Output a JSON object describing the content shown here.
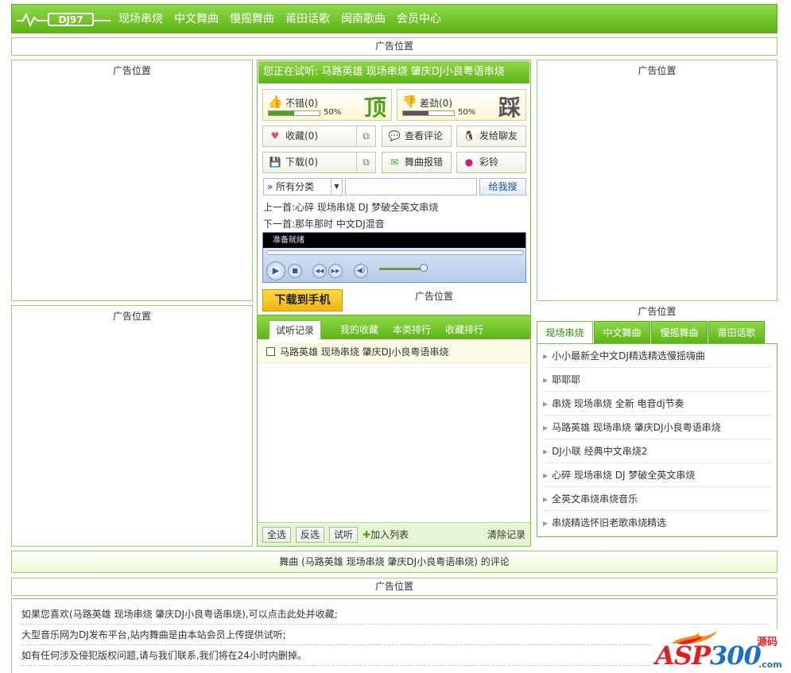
{
  "header": {
    "logo_text": "DJ97",
    "nav": [
      "现场串烧",
      "中文舞曲",
      "慢摇舞曲",
      "莆田话歌",
      "闽南歌曲",
      "会员中心"
    ]
  },
  "ads": {
    "label": "广告位置"
  },
  "player": {
    "now_playing": "您正在试听: 马路英雄 现场串烧 肇庆DJ小良粤语串烧",
    "up_vote": {
      "label": "不错(0)",
      "percent_text": "50%",
      "percent": 50,
      "big": "顶",
      "color": "#4ca21b"
    },
    "down_vote": {
      "label": "差劲(0)",
      "percent_text": "50%",
      "percent": 50,
      "big": "踩",
      "color": "#555555"
    },
    "actions": {
      "favorite": "收藏(0)",
      "comments": "查看评论",
      "send_friend": "发给聊友",
      "download": "下载(0)",
      "report": "舞曲报错",
      "ringtone": "彩铃"
    },
    "category_select": "» 所有分类",
    "search_placeholder": "",
    "search_button": "给我搜",
    "prev": {
      "prefix": "上一首:",
      "name": "心碎 现场串烧 DJ 梦破全英文串烧"
    },
    "next": {
      "prefix": "下一首:",
      "name": "那年那时 中文DJ混音"
    },
    "screen_text": "准备就绪",
    "download_phone": "下载到手机"
  },
  "playlist": {
    "tabs": [
      "试听记录",
      "我的收藏",
      "本类排行",
      "收藏排行"
    ],
    "rows": [
      "马路英雄 现场串烧 肇庆DJ小良粤语串烧"
    ],
    "select_all": "全选",
    "invert": "反选",
    "listen": "试听",
    "add_to_list": "加入列表",
    "clear": "清除记录"
  },
  "right_list": {
    "tabs": [
      "现场串烧",
      "中文舞曲",
      "慢摇舞曲",
      "莆田话歌"
    ],
    "items": [
      "小小最新全中文DJ精选精选慢摇嗨曲",
      "耶耶耶",
      "串烧 现场串烧 全新 电音dj节奏",
      "马路英雄 现场串烧 肇庆DJ小良粤语串烧",
      "DJ小联 经典中文串烧2",
      "心碎 现场串烧 DJ 梦破全英文串烧",
      "全英文串烧串烧音乐",
      "串烧精选怀旧老歌串烧精选"
    ]
  },
  "comments_title": "舞曲 (马路英雄 现场串烧 肇庆DJ小良粤语串烧) 的评论",
  "notes": [
    "如果您喜欢(马路英雄 现场串烧 肇庆DJ小良粤语串烧),可以点击此处并收藏;",
    "大型音乐网为DJ发布平台,站内舞曲是由本站会员上传提供试听;",
    "如有任何涉及侵犯版权问题,请与我们联系,我们将在24小时内删掉。"
  ],
  "watermark": {
    "main": "ASP",
    "num": "300",
    "side": "源码",
    "sub": ".com"
  },
  "colors": {
    "brand_green": "#5cb514",
    "border_green": "#9ccf72",
    "accent_yellow": "#f0b60d"
  }
}
